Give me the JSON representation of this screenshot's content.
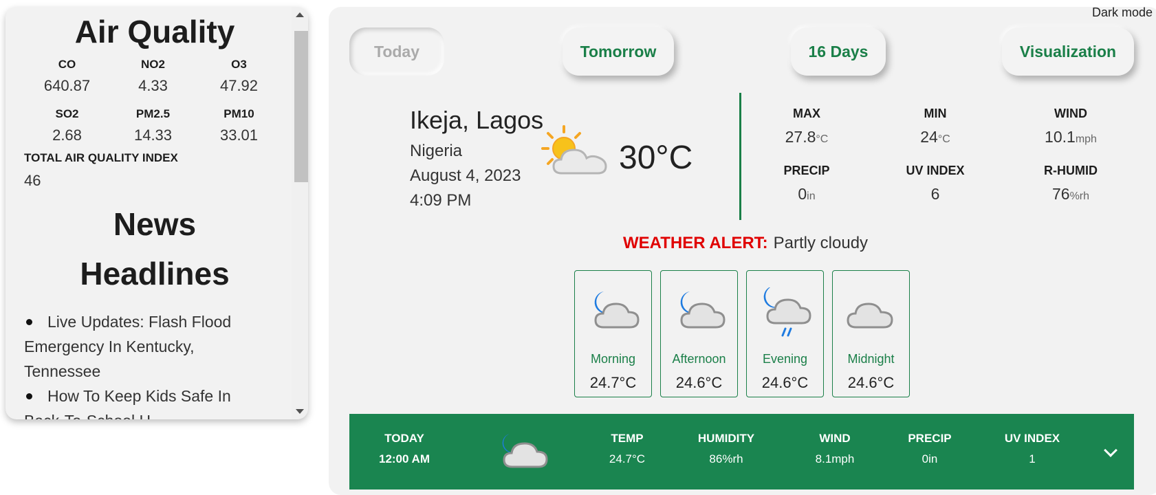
{
  "air_quality": {
    "title": "Air Quality",
    "pollutants": [
      {
        "label": "CO",
        "value": "640.87"
      },
      {
        "label": "NO2",
        "value": "4.33"
      },
      {
        "label": "O3",
        "value": "47.92"
      },
      {
        "label": "SO2",
        "value": "2.68"
      },
      {
        "label": "PM2.5",
        "value": "14.33"
      },
      {
        "label": "PM10",
        "value": "33.01"
      }
    ],
    "index_label": "TOTAL AIR QUALITY INDEX",
    "index_value": "46"
  },
  "news": {
    "title_line1": "News",
    "title_line2": "Headlines",
    "items": [
      "Live Updates: Flash Flood Emergency In Kentucky, Tennessee",
      "How To Keep Kids Safe In Back-To-School H..."
    ]
  },
  "header": {
    "dark_mode_label": "Dark mode"
  },
  "tabs": [
    {
      "label": "Today"
    },
    {
      "label": "Tomorrow"
    },
    {
      "label": "16 Days"
    },
    {
      "label": "Visualization"
    }
  ],
  "location": {
    "city": "Ikeja, Lagos",
    "country": "Nigeria",
    "date": "August 4, 2023",
    "time": "4:09 PM"
  },
  "current": {
    "temperature": "30°C",
    "icon": "partly-sunny-icon"
  },
  "stats": [
    {
      "label": "MAX",
      "value": "27.8",
      "unit": "°C"
    },
    {
      "label": "MIN",
      "value": "24",
      "unit": "°C"
    },
    {
      "label": "WIND",
      "value": "10.1",
      "unit": "mph"
    },
    {
      "label": "PRECIP",
      "value": "0",
      "unit": "in"
    },
    {
      "label": "UV INDEX",
      "value": "6",
      "unit": ""
    },
    {
      "label": "R-HUMID",
      "value": "76",
      "unit": "%rh"
    }
  ],
  "alert": {
    "label": "WEATHER ALERT:",
    "text": "Partly cloudy"
  },
  "day_parts": [
    {
      "label": "Morning",
      "temp": "24.7°C",
      "icon": "moon-cloud-icon"
    },
    {
      "label": "Afternoon",
      "temp": "24.6°C",
      "icon": "moon-cloud-icon"
    },
    {
      "label": "Evening",
      "temp": "24.6°C",
      "icon": "moon-cloud-rain-icon"
    },
    {
      "label": "Midnight",
      "temp": "24.6°C",
      "icon": "cloud-icon"
    }
  ],
  "hourly": {
    "day": "TODAY",
    "time": "12:00 AM",
    "icon": "moon-cloud-icon",
    "temp_label": "TEMP",
    "temp_value": "24.7°C",
    "humidity_label": "HUMIDITY",
    "humidity_value": "86%rh",
    "wind_label": "WIND",
    "wind_value": "8.1mph",
    "precip_label": "PRECIP",
    "precip_value": "0in",
    "uv_label": "UV INDEX",
    "uv_value": "1"
  },
  "colors": {
    "accent_green": "#1a7f48",
    "alert_red": "#e00000",
    "panel_bg": "#f2f2f2"
  }
}
